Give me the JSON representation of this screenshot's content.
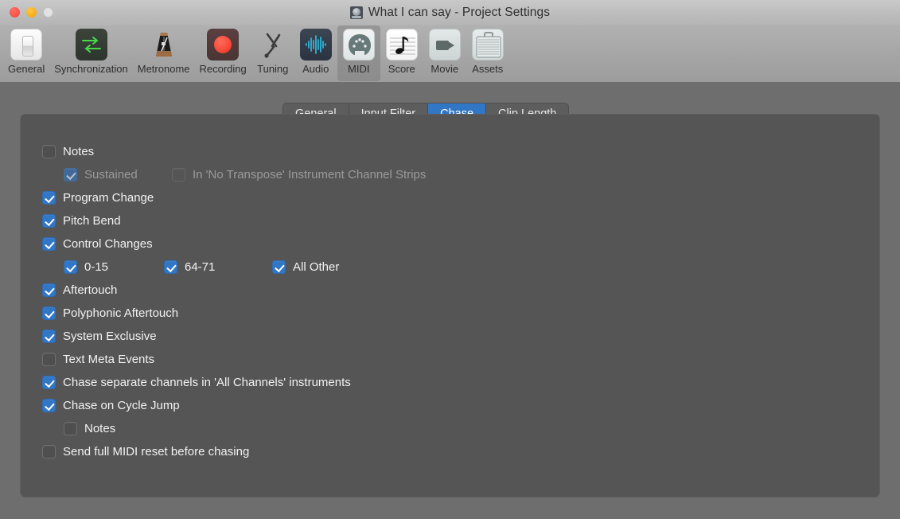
{
  "window": {
    "title": "What I can say - Project Settings",
    "doc_icon": "project-document-icon",
    "traffic": {
      "close": "close-button",
      "minimize": "minimize-button",
      "zoom": "zoom-button"
    }
  },
  "toolbar": {
    "items": [
      {
        "label": "General",
        "icon": "light-switch-icon",
        "selected": false
      },
      {
        "label": "Synchronization",
        "icon": "sync-arrows-icon",
        "selected": false
      },
      {
        "label": "Metronome",
        "icon": "metronome-icon",
        "selected": false
      },
      {
        "label": "Recording",
        "icon": "record-dot-icon",
        "selected": false
      },
      {
        "label": "Tuning",
        "icon": "tuning-fork-icon",
        "selected": false
      },
      {
        "label": "Audio",
        "icon": "waveform-icon",
        "selected": false
      },
      {
        "label": "MIDI",
        "icon": "midi-din-connector-icon",
        "selected": true
      },
      {
        "label": "Score",
        "icon": "music-note-staff-icon",
        "selected": false
      },
      {
        "label": "Movie",
        "icon": "video-camera-icon",
        "selected": false
      },
      {
        "label": "Assets",
        "icon": "briefcase-icon",
        "selected": false
      }
    ]
  },
  "tabs": [
    {
      "label": "General",
      "active": false
    },
    {
      "label": "Input Filter",
      "active": false
    },
    {
      "label": "Chase",
      "active": true
    },
    {
      "label": "Clip Length",
      "active": false
    }
  ],
  "settings": {
    "notes": {
      "label": "Notes",
      "checked": false,
      "enabled": true
    },
    "sustained": {
      "label": "Sustained",
      "checked": true,
      "enabled": false
    },
    "no_transpose": {
      "label": "In 'No Transpose' Instrument Channel Strips",
      "checked": false,
      "enabled": false
    },
    "program_change": {
      "label": "Program Change",
      "checked": true,
      "enabled": true
    },
    "pitch_bend": {
      "label": "Pitch Bend",
      "checked": true,
      "enabled": true
    },
    "control_changes": {
      "label": "Control Changes",
      "checked": true,
      "enabled": true
    },
    "cc_0_15": {
      "label": "0-15",
      "checked": true,
      "enabled": true
    },
    "cc_64_71": {
      "label": "64-71",
      "checked": true,
      "enabled": true
    },
    "cc_all_other": {
      "label": "All Other",
      "checked": true,
      "enabled": true
    },
    "aftertouch": {
      "label": "Aftertouch",
      "checked": true,
      "enabled": true
    },
    "poly_aftertouch": {
      "label": "Polyphonic Aftertouch",
      "checked": true,
      "enabled": true
    },
    "system_exclusive": {
      "label": "System Exclusive",
      "checked": true,
      "enabled": true
    },
    "text_meta_events": {
      "label": "Text Meta Events",
      "checked": false,
      "enabled": true
    },
    "chase_separate": {
      "label": "Chase separate channels in 'All Channels' instruments",
      "checked": true,
      "enabled": true
    },
    "chase_cycle_jump": {
      "label": "Chase on Cycle Jump",
      "checked": true,
      "enabled": true
    },
    "cycle_jump_notes": {
      "label": "Notes",
      "checked": false,
      "enabled": true
    },
    "send_full_midi_reset": {
      "label": "Send full MIDI reset before chasing",
      "checked": false,
      "enabled": true
    }
  },
  "colors": {
    "accent_blue": "#3277c6",
    "panel_bg": "#555555",
    "window_bg": "#6e6e6e",
    "titlebar": "#bdbdbd",
    "text": "#f2f2f2",
    "text_dim": "#9a9a9a"
  }
}
